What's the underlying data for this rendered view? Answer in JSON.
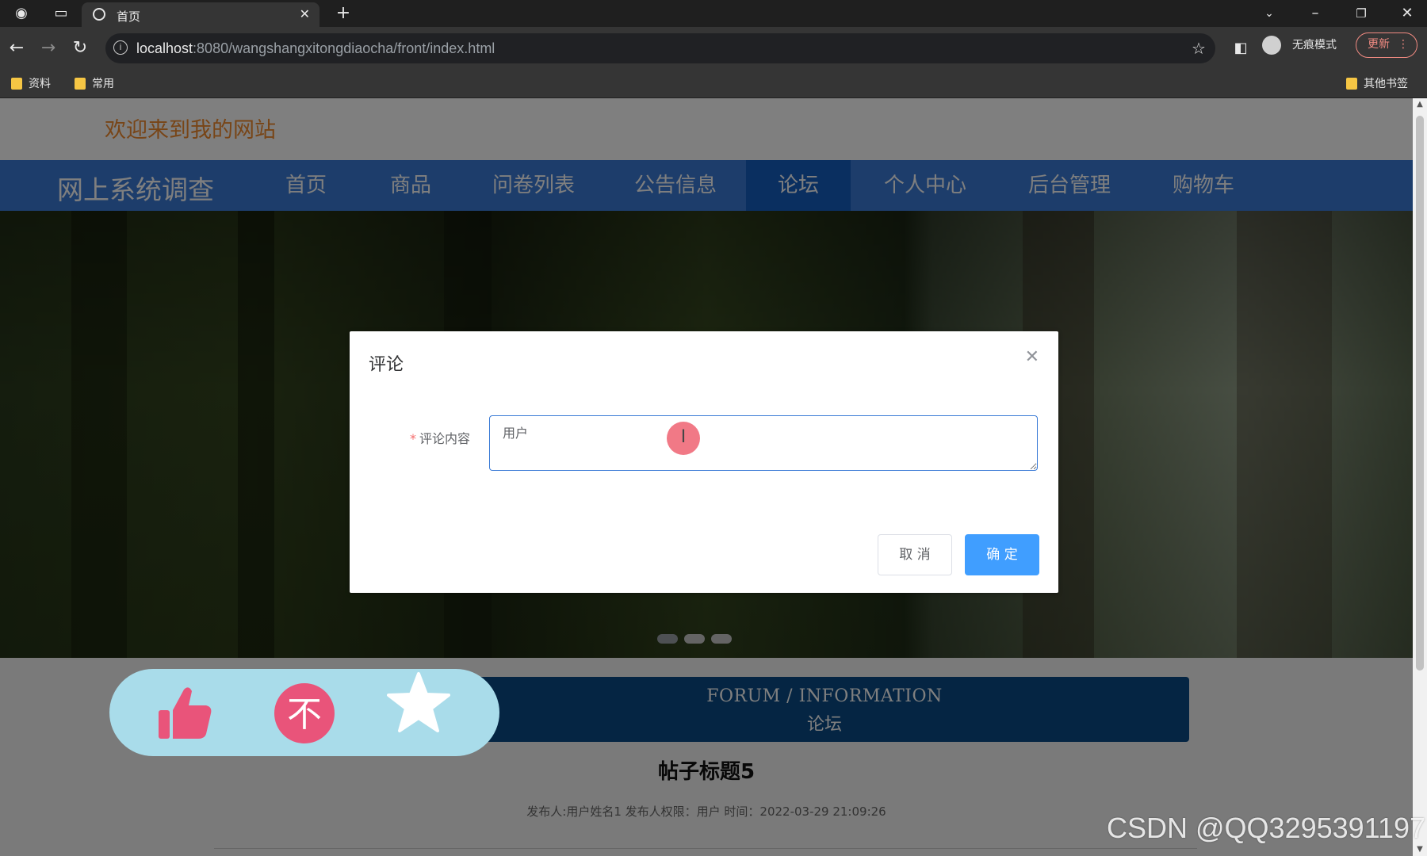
{
  "browser": {
    "tab_title": "首页",
    "url_host": "localhost",
    "url_rest": ":8080/wangshangxitongdiaocha/front/index.html",
    "incognito_label": "无痕模式",
    "update_label": "更新",
    "bookmarks": [
      {
        "label": "资料"
      },
      {
        "label": "常用"
      }
    ],
    "other_bookmarks": "其他书签"
  },
  "site": {
    "welcome": "欢迎来到我的网站",
    "brand": "网上系统调查",
    "nav": [
      {
        "label": "首页"
      },
      {
        "label": "商品"
      },
      {
        "label": "问卷列表"
      },
      {
        "label": "公告信息"
      },
      {
        "label": "论坛",
        "active": true
      },
      {
        "label": "个人中心"
      },
      {
        "label": "后台管理"
      },
      {
        "label": "购物车"
      }
    ]
  },
  "forum": {
    "banner_en": "FORUM / INFORMATION",
    "banner_cn": "论坛",
    "post_title": "帖子标题5",
    "post_meta": "发布人:用户姓名1   发布人权限：用户   时间：2022-03-29 21:09:26"
  },
  "dialog": {
    "title": "评论",
    "required_mark": "*",
    "field_label": "评论内容",
    "field_value": "用户",
    "cancel": "取 消",
    "confirm": "确 定"
  },
  "floating_actions": [
    {
      "icon": "thumbs-up-icon"
    },
    {
      "icon": "downvote-icon",
      "glyph": "不"
    },
    {
      "icon": "star-icon"
    }
  ],
  "carousel": {
    "slides": 3,
    "current": 1
  },
  "watermark": "CSDN @QQ3295391197",
  "colors": {
    "nav_bg": "#3b7bd6",
    "nav_active": "#155ec1",
    "welcome": "#f18b2f",
    "primary_button": "#409eff",
    "forum_banner": "#0b4b86",
    "pill": "#a9dcea",
    "pill_icon": "#e9547a"
  }
}
